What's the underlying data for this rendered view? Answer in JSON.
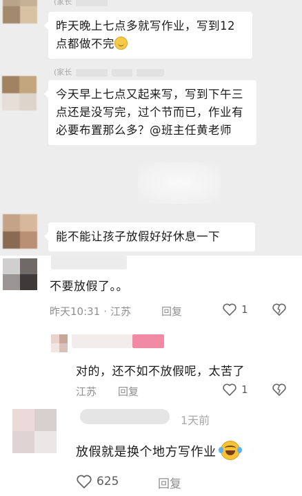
{
  "chat": {
    "sender_label_1": "(家长",
    "sender_label_2": "(家长",
    "messages": [
      {
        "text": "昨天晚上七点多就写作业，写到12点都做不完"
      },
      {
        "text": "今天早上七点又起来写，写到下午三点还是没写完，过个节而已，作业有必要布置那么多？@班主任黄老师"
      },
      {
        "text": "能不能让孩子放假好好休息一下"
      }
    ]
  },
  "comments": [
    {
      "text": "不要放假了。。",
      "time": "昨天10:31",
      "location": "江苏",
      "reply_label": "回复",
      "likes": "1"
    },
    {
      "text": "对的，还不如不放假呢，太苦了",
      "location": "江苏",
      "reply_label": "回复",
      "likes": "1"
    },
    {
      "text": "放假就是换个地方写作业",
      "time_ago": "1天前",
      "reply_label": "回复",
      "likes": "625"
    }
  ],
  "icons": {
    "like": "heart-outline-icon",
    "dislike": "broken-heart-icon",
    "emoji_smile": "smile-emoji-icon",
    "emoji_laugh": "laugh-cry-emoji-icon"
  },
  "colors": {
    "chat_bg": "#ededed",
    "bubble_bg": "#ffffff",
    "meta_text": "#8f8f8f"
  }
}
